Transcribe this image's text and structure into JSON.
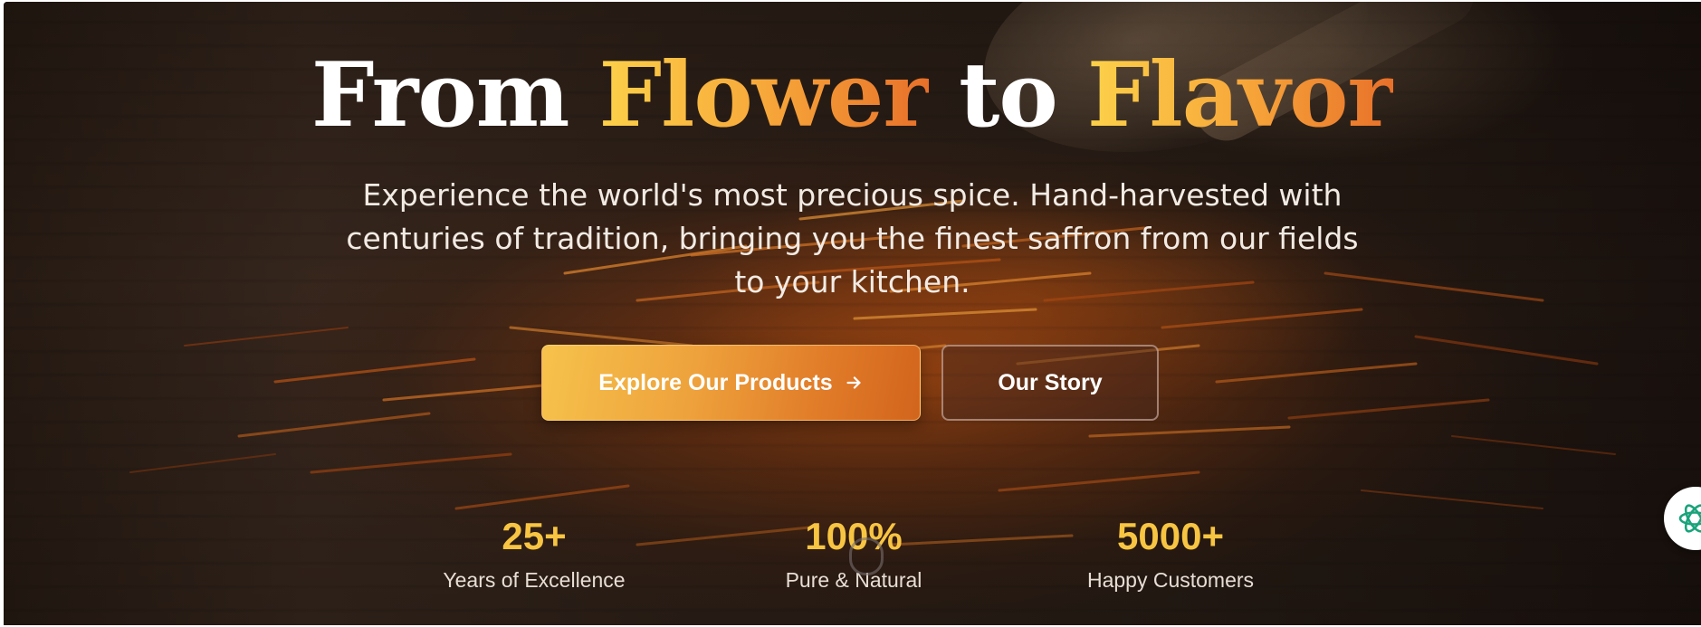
{
  "hero": {
    "headline": {
      "part1": "From ",
      "part2": "Flower",
      "part3": " to ",
      "part4": "Flavor"
    },
    "subtitle": "Experience the world's most precious spice. Hand-harvested with centuries of tradition, bringing you the finest saffron from our fields to your kitchen.",
    "buttons": {
      "primary_label": "Explore Our Products",
      "primary_icon": "arrow-right-icon",
      "secondary_label": "Our Story"
    },
    "stats": [
      {
        "value": "25+",
        "label": "Years of Excellence"
      },
      {
        "value": "100%",
        "label": "Pure & Natural"
      },
      {
        "value": "5000+",
        "label": "Happy Customers"
      }
    ]
  },
  "widget": {
    "icon": "atom-icon",
    "color": "#1aa37a"
  },
  "colors": {
    "accent_gold": "#f8c542",
    "accent_orange": "#e07a28",
    "text_light": "#f2ebe4"
  }
}
